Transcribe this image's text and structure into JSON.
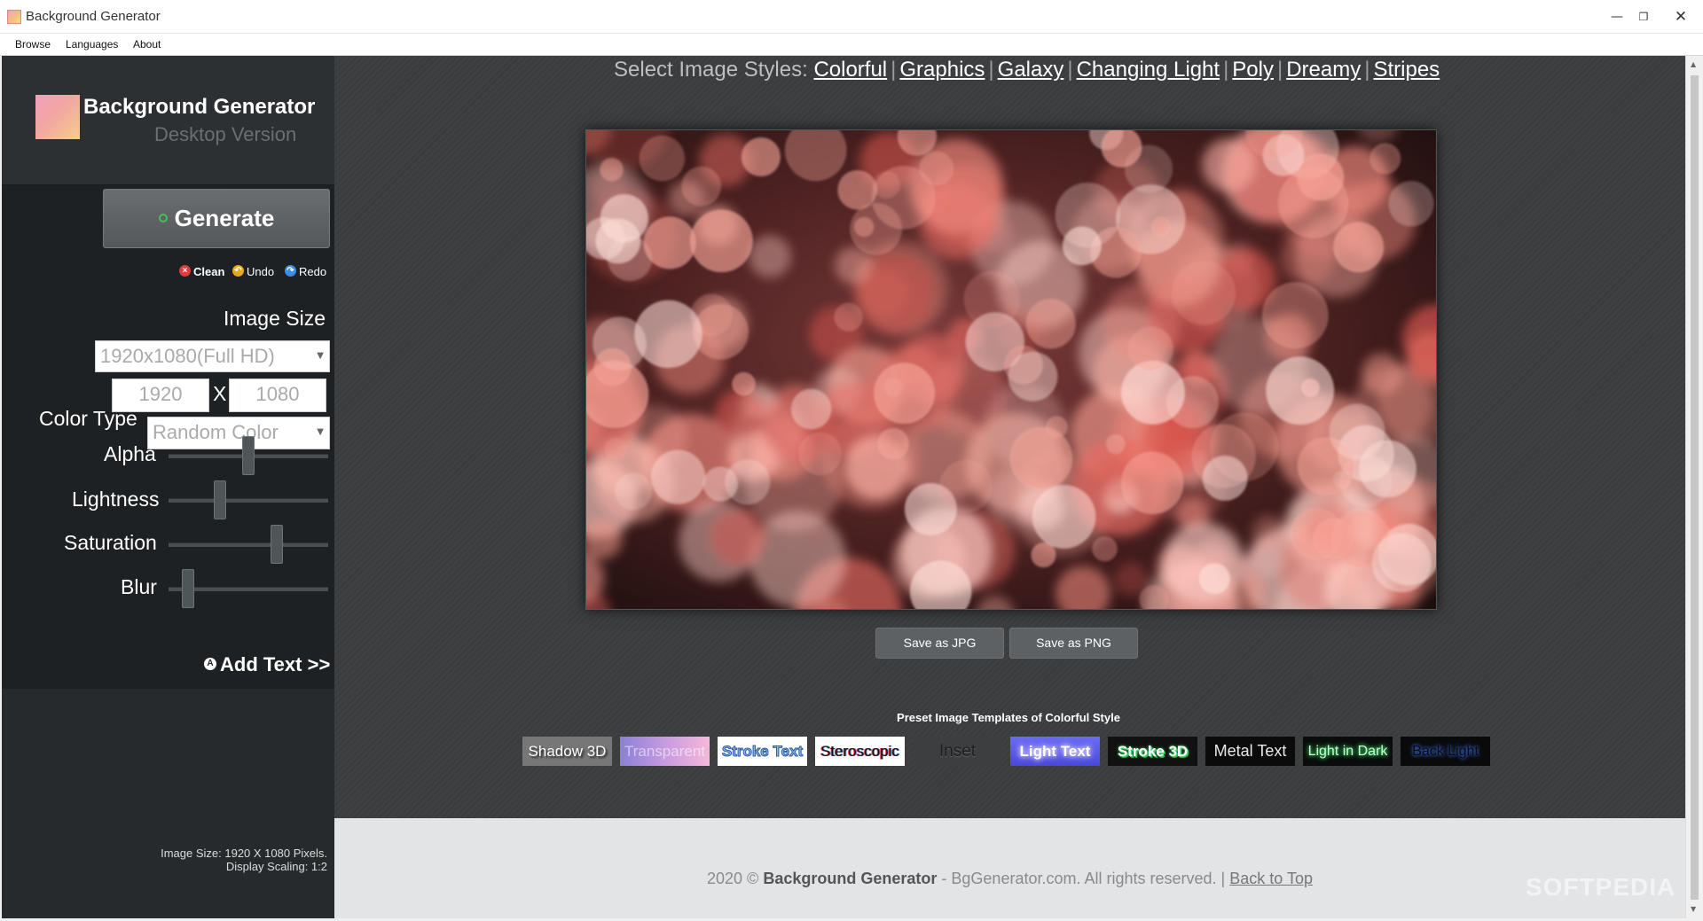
{
  "window": {
    "title": "Background Generator"
  },
  "menu": [
    "Browse",
    "Languages",
    "About"
  ],
  "sidebar": {
    "app_name": "Background Generator",
    "app_sub": "Desktop Version",
    "generate_label": "Generate",
    "actions": {
      "clean": "Clean",
      "undo": "Undo",
      "redo": "Redo"
    },
    "image_size_label": "Image Size",
    "image_size_value": "1920x1080(Full HD)",
    "width_value": "1920",
    "height_value": "1080",
    "x_sep": "X",
    "color_type_label": "Color Type",
    "color_type_value": "Random Color",
    "sliders": {
      "alpha": {
        "label": "Alpha",
        "value": 0.5
      },
      "lightness": {
        "label": "Lightness",
        "value": 0.32
      },
      "saturation": {
        "label": "Saturation",
        "value": 0.68
      },
      "blur": {
        "label": "Blur",
        "value": 0.12
      }
    },
    "add_text": "Add Text >>",
    "info_line1": "Image Size: 1920 X 1080 Pixels.",
    "info_line2": "Display Scaling: 1:2"
  },
  "main": {
    "styles_prefix": "Select Image Styles:",
    "styles": [
      "Colorful",
      "Graphics",
      "Galaxy",
      "Changing Light",
      "Poly",
      "Dreamy",
      "Stripes"
    ],
    "save_jpg": "Save as JPG",
    "save_png": "Save as PNG",
    "preset_title": "Preset Image Templates of Colorful Style",
    "presets": [
      "Shadow 3D",
      "Transparent",
      "Stroke Text",
      "Steroscopic",
      "Inset",
      "Light Text",
      "Stroke 3D",
      "Metal Text",
      "Light in Dark",
      "Back Light"
    ]
  },
  "footer": {
    "year": "2020 ©",
    "brand": "Background Generator",
    "rest": "- BgGenerator.com. All rights reserved. |",
    "back_to_top": "Back to Top"
  },
  "watermark": "SOFTPEDIA"
}
